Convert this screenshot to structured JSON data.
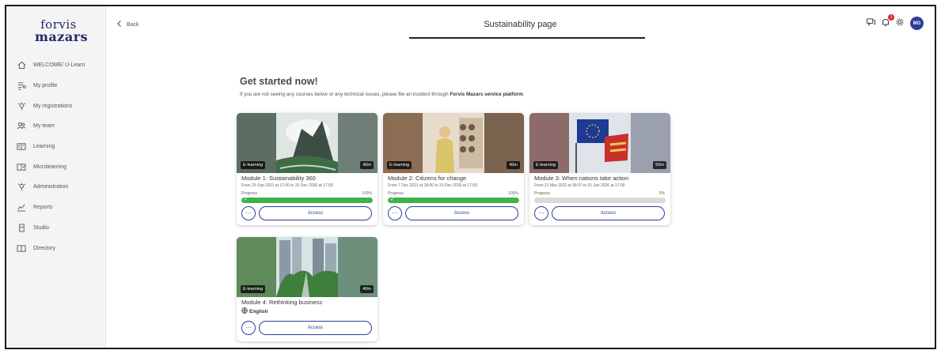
{
  "logo": {
    "line1": "forvis",
    "line2": "mazars"
  },
  "sidebar": {
    "items": [
      {
        "label": "WELCOME/ U-Learn",
        "icon": "home-icon"
      },
      {
        "label": "My profile",
        "icon": "profile-icon"
      },
      {
        "label": "My registrations",
        "icon": "registrations-icon"
      },
      {
        "label": "My team",
        "icon": "team-icon"
      },
      {
        "label": "Learning",
        "icon": "learning-icon"
      },
      {
        "label": "Microlearning",
        "icon": "microlearning-icon"
      },
      {
        "label": "Administration",
        "icon": "administration-icon"
      },
      {
        "label": "Reports",
        "icon": "reports-icon"
      },
      {
        "label": "Studio",
        "icon": "studio-icon"
      },
      {
        "label": "Directory",
        "icon": "directory-icon"
      }
    ]
  },
  "topbar": {
    "back_label": "Back",
    "page_title": "Sustainability page",
    "notification_count": "1",
    "avatar_initials": "MG"
  },
  "main": {
    "heading": "Get started now!",
    "subtext_prefix": "If you are not seeing any courses below or any technical issues, please file an incident through ",
    "subtext_link": "Forvis Mazars service platform",
    "subtext_suffix": "."
  },
  "cards": [
    {
      "type": "E-learning",
      "duration": "40m",
      "title": "Module 1: Sustainability 360",
      "dates": "From 29 Sep 2021 at 17:00 to 31 Dec 2030 at 17:59",
      "progress_label": "Progress",
      "progress_text": "100%",
      "progress": 1.0,
      "check": "✓",
      "more_label": "···",
      "access_label": "Access"
    },
    {
      "type": "E-learning",
      "duration": "40m",
      "title": "Module 2: Citizens for change",
      "dates": "From 7 Dec 2021 at 18:00 to 31 Dec 2030 at 17:59",
      "progress_label": "Progress",
      "progress_text": "100%",
      "progress": 1.0,
      "check": "✓",
      "more_label": "···",
      "access_label": "Access"
    },
    {
      "type": "E-learning",
      "duration": "50m",
      "title": "Module 3: When nations take action",
      "dates": "From 21 Mar 2022 at 06:07 to 31 Jan 2026 at 17:00",
      "progress_label": "Progress",
      "progress_text": "0%",
      "progress": 0.0,
      "more_label": "···",
      "access_label": "Access"
    },
    {
      "type": "E-learning",
      "duration": "40m",
      "title": "Module 4: Rethinking business",
      "language": "English",
      "more_label": "···",
      "access_label": "Access"
    }
  ],
  "colors": {
    "brand_blue": "#2f3d9b",
    "progress_green": "#3cb44b",
    "notification_red": "#e0262b"
  }
}
